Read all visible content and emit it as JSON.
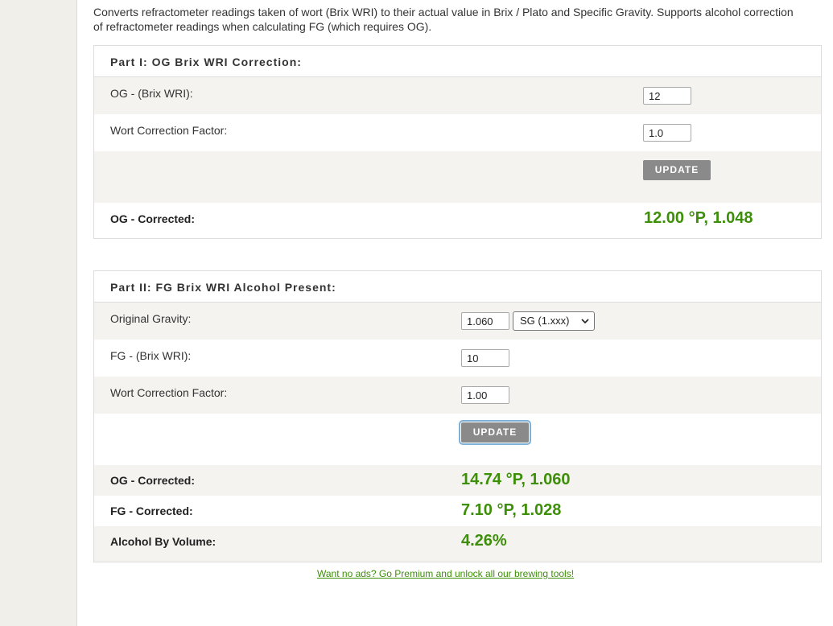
{
  "intro": "Converts refractometer readings taken of wort (Brix WRI) to their actual value in Brix / Plato and Specific Gravity. Supports alcohol correction of refractometer readings when calculating FG (which requires OG).",
  "part1": {
    "title": "Part I: OG Brix WRI Correction:",
    "og_label": "OG - (Brix WRI):",
    "og_value": "12",
    "wcf_label": "Wort Correction Factor:",
    "wcf_value": "1.0",
    "update_label": "UPDATE",
    "result_label": "OG - Corrected:",
    "result_value": "12.00 °P, 1.048"
  },
  "part2": {
    "title": "Part II: FG Brix WRI Alcohol Present:",
    "og_label": "Original Gravity:",
    "og_value": "1.060",
    "og_unit_selected": "SG (1.xxx)",
    "fg_label": "FG - (Brix WRI):",
    "fg_value": "10",
    "wcf_label": "Wort Correction Factor:",
    "wcf_value": "1.00",
    "update_label": "UPDATE",
    "og_corrected_label": "OG - Corrected:",
    "og_corrected_value": "14.74 °P, 1.060",
    "fg_corrected_label": "FG - Corrected:",
    "fg_corrected_value": "7.10 °P, 1.028",
    "abv_label": "Alcohol By Volume:",
    "abv_value": "4.26%"
  },
  "premium_link": "Want no ads? Go Premium and unlock all our brewing tools!",
  "colors": {
    "accent_green": "#3d8f09",
    "button_grey": "#8a8a8a",
    "row_grey": "#f4f3f0"
  }
}
